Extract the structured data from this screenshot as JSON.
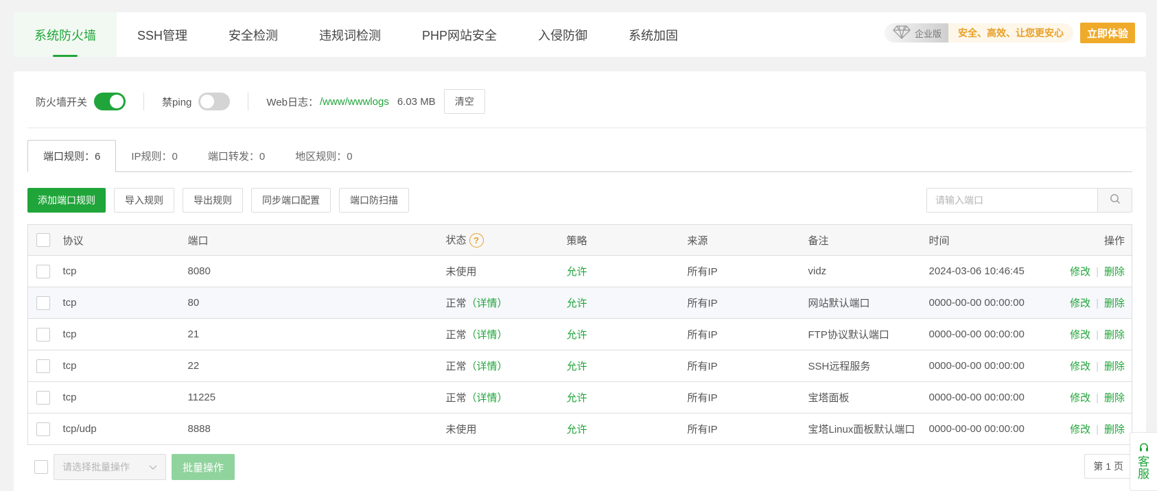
{
  "nav": {
    "tabs": [
      "系统防火墙",
      "SSH管理",
      "安全检测",
      "违规词检测",
      "PHP网站安全",
      "入侵防御",
      "系统加固"
    ],
    "enterprise": {
      "badge": "企业版",
      "slogan": "安全、高效、让您更安心",
      "button": "立即体验"
    }
  },
  "switches": {
    "firewall_label": "防火墙开关",
    "firewall_on": true,
    "ping_label": "禁ping",
    "ping_on": false,
    "weblog_label": "Web日志：",
    "weblog_path": "/www/wwwlogs",
    "weblog_size": "6.03 MB",
    "clear_button": "清空"
  },
  "subtabs": [
    "端口规则：6",
    "IP规则：0",
    "端口转发：0",
    "地区规则：0"
  ],
  "toolbar": {
    "add": "添加端口规则",
    "import": "导入规则",
    "export": "导出规则",
    "sync": "同步端口配置",
    "scan": "端口防扫描",
    "search_placeholder": "请输入端口"
  },
  "table": {
    "headers": [
      "协议",
      "端口",
      "状态",
      "策略",
      "来源",
      "备注",
      "时间",
      "操作"
    ],
    "status_help": "?",
    "rows": [
      {
        "protocol": "tcp",
        "port": "8080",
        "status": "未使用",
        "detail": "",
        "policy": "允许",
        "source": "所有IP",
        "note": "vidz",
        "time": "2024-03-06 10:46:45"
      },
      {
        "protocol": "tcp",
        "port": "80",
        "status": "正常",
        "detail": "（详情）",
        "policy": "允许",
        "source": "所有IP",
        "note": "网站默认端口",
        "time": "0000-00-00 00:00:00"
      },
      {
        "protocol": "tcp",
        "port": "21",
        "status": "正常",
        "detail": "（详情）",
        "policy": "允许",
        "source": "所有IP",
        "note": "FTP协议默认端口",
        "time": "0000-00-00 00:00:00"
      },
      {
        "protocol": "tcp",
        "port": "22",
        "status": "正常",
        "detail": "（详情）",
        "policy": "允许",
        "source": "所有IP",
        "note": "SSH远程服务",
        "time": "0000-00-00 00:00:00"
      },
      {
        "protocol": "tcp",
        "port": "11225",
        "status": "正常",
        "detail": "（详情）",
        "policy": "允许",
        "source": "所有IP",
        "note": "宝塔面板",
        "time": "0000-00-00 00:00:00"
      },
      {
        "protocol": "tcp/udp",
        "port": "8888",
        "status": "未使用",
        "detail": "",
        "policy": "允许",
        "source": "所有IP",
        "note": "宝塔Linux面板默认端口",
        "time": "0000-00-00 00:00:00"
      }
    ],
    "edit": "修改",
    "delete": "删除"
  },
  "footer": {
    "batch_placeholder": "请选择批量操作",
    "batch_button": "批量操作",
    "page": "第 1 页"
  },
  "service": {
    "label1": "客",
    "label2": "服"
  }
}
